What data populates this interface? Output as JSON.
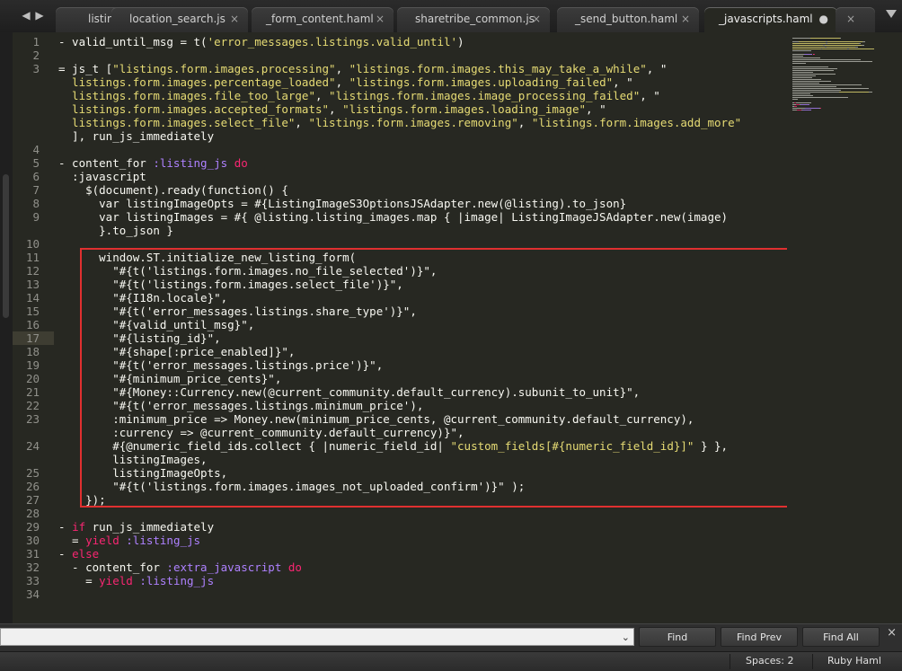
{
  "tabs": [
    {
      "label": "listing",
      "close": "×"
    },
    {
      "label": "location_search.js",
      "close": "×"
    },
    {
      "label": "_form_content.haml",
      "close": "×"
    },
    {
      "label": "sharetribe_common.js",
      "close": "×"
    },
    {
      "label": "_send_button.haml",
      "close": "×"
    },
    {
      "label": "_javascripts.haml",
      "close": "●"
    },
    {
      "label": "",
      "close": "×"
    }
  ],
  "nav": {
    "back": "◀",
    "forward": "▶"
  },
  "lines": [
    {
      "n": "1",
      "t": [
        [
          "p",
          "- valid_until_msg = t("
        ],
        [
          "s",
          "'error_messages.listings.valid_until'"
        ],
        [
          "p",
          ")"
        ]
      ]
    },
    {
      "n": "2",
      "t": []
    },
    {
      "n": "3",
      "t": [
        [
          "p",
          "= js_t ["
        ],
        [
          "s",
          "\"listings.form.images.processing\""
        ],
        [
          "p",
          ", "
        ],
        [
          "s",
          "\"listings.form.images.this_may_take_a_while\""
        ],
        [
          "p",
          ", \""
        ]
      ]
    },
    {
      "n": "",
      "t": [
        [
          "s",
          "  listings.form.images.percentage_loaded\""
        ],
        [
          "p",
          ", "
        ],
        [
          "s",
          "\"listings.form.images.uploading_failed\""
        ],
        [
          "p",
          ", \""
        ]
      ]
    },
    {
      "n": "",
      "t": [
        [
          "s",
          "  listings.form.images.file_too_large\""
        ],
        [
          "p",
          ", "
        ],
        [
          "s",
          "\"listings.form.images.image_processing_failed\""
        ],
        [
          "p",
          ", \""
        ]
      ]
    },
    {
      "n": "",
      "t": [
        [
          "s",
          "  listings.form.images.accepted_formats\""
        ],
        [
          "p",
          ", "
        ],
        [
          "s",
          "\"listings.form.images.loading_image\""
        ],
        [
          "p",
          ", \""
        ]
      ]
    },
    {
      "n": "",
      "t": [
        [
          "s",
          "  listings.form.images.select_file\""
        ],
        [
          "p",
          ", "
        ],
        [
          "s",
          "\"listings.form.images.removing\""
        ],
        [
          "p",
          ", "
        ],
        [
          "s",
          "\"listings.form.images.add_more\""
        ]
      ]
    },
    {
      "n": "",
      "t": [
        [
          "p",
          "  ], run_js_immediately"
        ]
      ]
    },
    {
      "n": "4",
      "t": []
    },
    {
      "n": "5",
      "t": [
        [
          "p",
          "- content_for "
        ],
        [
          "sym",
          ":listing_js"
        ],
        [
          "p",
          " "
        ],
        [
          "k",
          "do"
        ]
      ]
    },
    {
      "n": "6",
      "t": [
        [
          "p",
          "  :javascript"
        ]
      ]
    },
    {
      "n": "7",
      "t": [
        [
          "p",
          "    $(document).ready(function() {"
        ]
      ]
    },
    {
      "n": "8",
      "t": [
        [
          "p",
          "      var listingImageOpts = #{ListingImageS3OptionsJSAdapter.new(@listing).to_json}"
        ]
      ]
    },
    {
      "n": "9",
      "t": [
        [
          "p",
          "      var listingImages = #{ @listing.listing_images.map { |image| ListingImageJSAdapter.new(image)"
        ]
      ]
    },
    {
      "n": "",
      "t": [
        [
          "p",
          "      }.to_json }"
        ]
      ]
    },
    {
      "n": "10",
      "t": []
    },
    {
      "n": "11",
      "t": [
        [
          "p",
          "      window.ST.initialize_new_listing_form("
        ]
      ]
    },
    {
      "n": "12",
      "t": [
        [
          "p",
          "        \"#{t('listings.form.images.no_file_selected')}\","
        ]
      ]
    },
    {
      "n": "13",
      "t": [
        [
          "p",
          "        \"#{t('listings.form.images.select_file')}\","
        ]
      ]
    },
    {
      "n": "14",
      "t": [
        [
          "p",
          "        \"#{I18n.locale}\","
        ]
      ]
    },
    {
      "n": "15",
      "t": [
        [
          "p",
          "        \"#{t('error_messages.listings.share_type')}\","
        ]
      ]
    },
    {
      "n": "16",
      "t": [
        [
          "p",
          "        \"#{valid_until_msg}\","
        ]
      ]
    },
    {
      "n": "17",
      "t": [
        [
          "p",
          "        \"#{listing_id}\","
        ]
      ],
      "current": true
    },
    {
      "n": "18",
      "t": [
        [
          "p",
          "        \"#{shape[:price_enabled]}\","
        ]
      ]
    },
    {
      "n": "19",
      "t": [
        [
          "p",
          "        \"#{t('error_messages.listings.price')}\","
        ]
      ]
    },
    {
      "n": "20",
      "t": [
        [
          "p",
          "        \"#{minimum_price_cents}\","
        ]
      ]
    },
    {
      "n": "21",
      "t": [
        [
          "p",
          "        \"#{Money::Currency.new(@current_community.default_currency).subunit_to_unit}\","
        ]
      ]
    },
    {
      "n": "22",
      "t": [
        [
          "p",
          "        \"#{t('error_messages.listings.minimum_price'),"
        ]
      ]
    },
    {
      "n": "23",
      "t": [
        [
          "p",
          "        :minimum_price => Money.new(minimum_price_cents, @current_community.default_currency),"
        ]
      ]
    },
    {
      "n": "",
      "t": [
        [
          "p",
          "        :currency => @current_community.default_currency)}\","
        ]
      ]
    },
    {
      "n": "24",
      "t": [
        [
          "p",
          "        #{@numeric_field_ids.collect { |numeric_field_id| "
        ],
        [
          "s",
          "\"custom_fields[#{numeric_field_id}]\""
        ],
        [
          "p",
          " } },"
        ]
      ]
    },
    {
      "n": "",
      "t": [
        [
          "p",
          "        listingImages,"
        ]
      ]
    },
    {
      "n": "25",
      "t": [
        [
          "p",
          "        listingImageOpts,"
        ]
      ]
    },
    {
      "n": "26",
      "t": [
        [
          "p",
          "        \"#{t('listings.form.images.images_not_uploaded_confirm')}\" );"
        ]
      ]
    },
    {
      "n": "27",
      "t": [
        [
          "p",
          "    });"
        ]
      ]
    },
    {
      "n": "28",
      "t": []
    },
    {
      "n": "29",
      "t": [
        [
          "p",
          "- "
        ],
        [
          "k",
          "if"
        ],
        [
          "p",
          " run_js_immediately"
        ]
      ]
    },
    {
      "n": "30",
      "t": [
        [
          "p",
          "  = "
        ],
        [
          "k",
          "yield"
        ],
        [
          "p",
          " "
        ],
        [
          "sym",
          ":listing_js"
        ]
      ]
    },
    {
      "n": "31",
      "t": [
        [
          "p",
          "- "
        ],
        [
          "k",
          "else"
        ]
      ]
    },
    {
      "n": "32",
      "t": [
        [
          "p",
          "  - content_for "
        ],
        [
          "sym",
          ":extra_javascript"
        ],
        [
          "p",
          " "
        ],
        [
          "k",
          "do"
        ]
      ]
    },
    {
      "n": "33",
      "t": [
        [
          "p",
          "    = "
        ],
        [
          "k",
          "yield"
        ],
        [
          "p",
          " "
        ],
        [
          "sym",
          ":listing_js"
        ]
      ]
    },
    {
      "n": "34",
      "t": []
    }
  ],
  "find": {
    "input_value": "",
    "find": "Find",
    "find_prev": "Find Prev",
    "find_all": "Find All",
    "close": "×",
    "dropdown": "⌄"
  },
  "status": {
    "spaces": "Spaces: 2",
    "syntax": "Ruby Haml"
  },
  "colors": {
    "background": "#272822",
    "string": "#e6db74",
    "keyword": "#f92672",
    "symbol": "#ae81ff",
    "highlight_border": "#e03030"
  }
}
